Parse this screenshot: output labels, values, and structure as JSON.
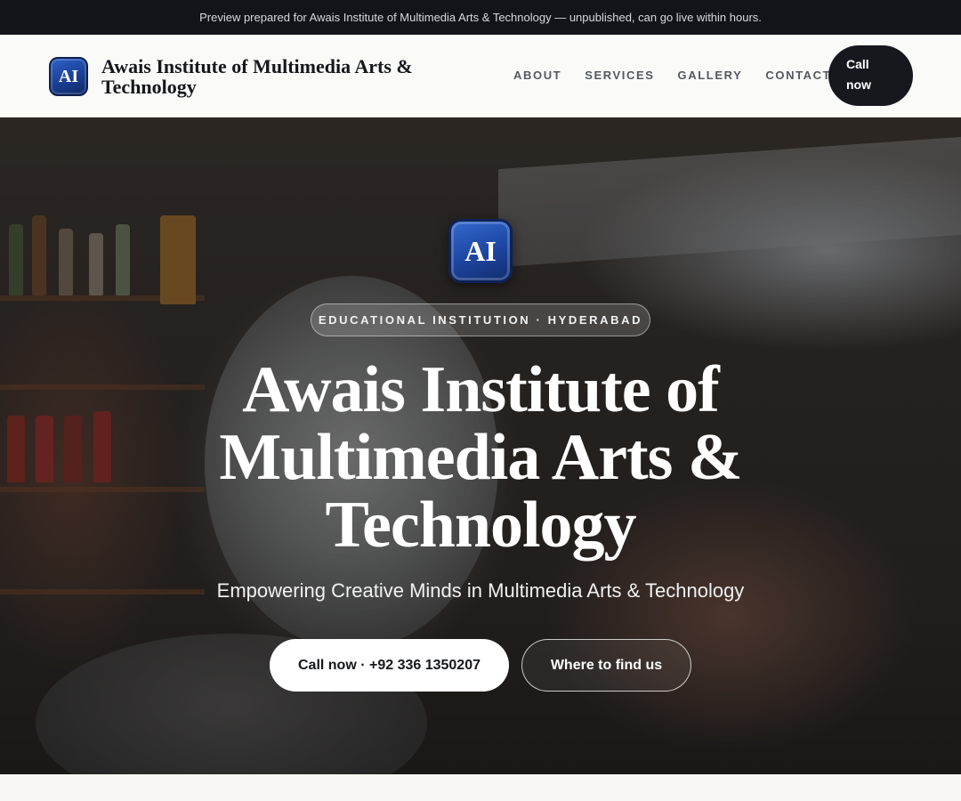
{
  "preview_bar": {
    "text": "Preview prepared for Awais Institute of Multimedia Arts & Technology — unpublished, can go live within hours."
  },
  "header": {
    "logo_text": "AI",
    "brand_name": "Awais Institute of Multimedia Arts & Technology",
    "nav": [
      "ABOUT",
      "SERVICES",
      "GALLERY",
      "CONTACT"
    ],
    "cta_label": "Call now"
  },
  "hero": {
    "logo_text": "AI",
    "badge": "EDUCATIONAL INSTITUTION · HYDERABAD",
    "title": "Awais Institute of Multimedia Arts & Technology",
    "subtitle": "Empowering Creative Minds in Multimedia Arts & Technology",
    "primary_button": "Call now · +92 336 1350207",
    "secondary_button": "Where to find us",
    "background_description_icon": "store-photo-background"
  },
  "colors": {
    "topbar_bg": "#121419",
    "header_bg": "#fafaf8",
    "brand_blue": "#1d45a0",
    "dark_button": "#16181e"
  }
}
